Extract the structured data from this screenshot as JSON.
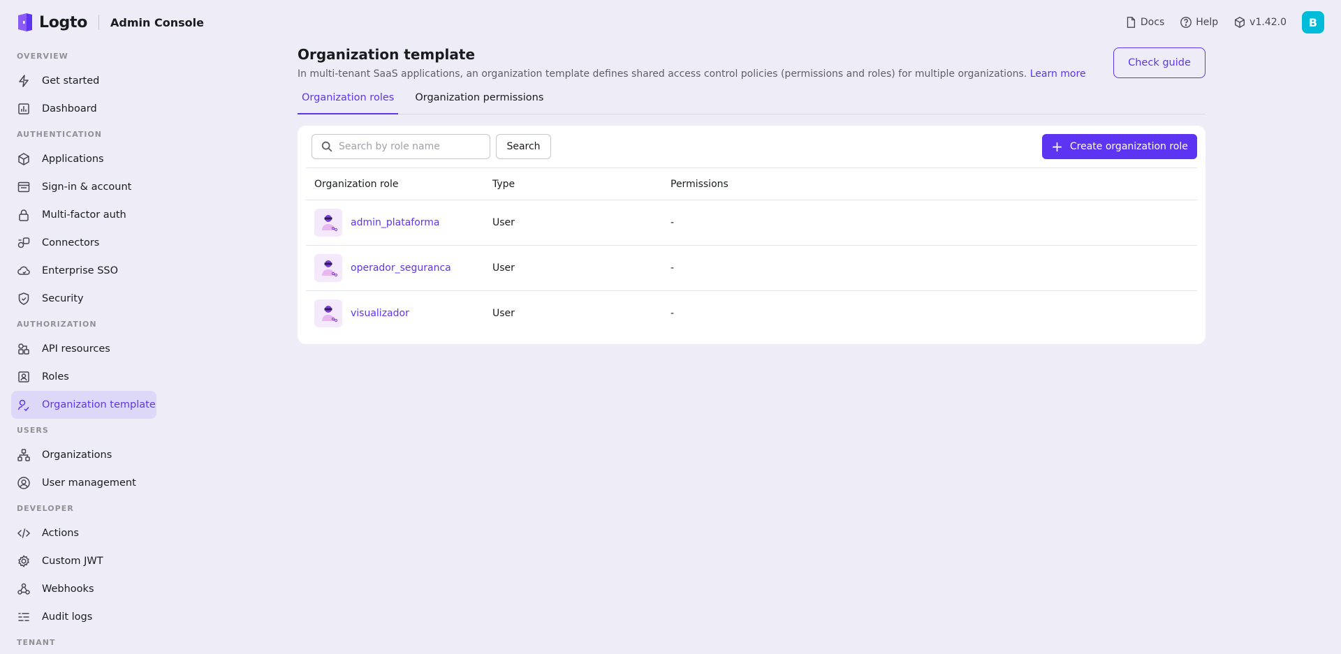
{
  "header": {
    "logo_text": "Logto",
    "app_title": "Admin Console",
    "docs_label": "Docs",
    "help_label": "Help",
    "version_label": "v1.42.0",
    "avatar_initial": "B"
  },
  "sidebar": {
    "sections": [
      {
        "title": "OVERVIEW",
        "items": [
          {
            "label": "Get started",
            "icon": "bolt-icon"
          },
          {
            "label": "Dashboard",
            "icon": "chart-icon"
          }
        ]
      },
      {
        "title": "AUTHENTICATION",
        "items": [
          {
            "label": "Applications",
            "icon": "cube-icon"
          },
          {
            "label": "Sign-in & account",
            "icon": "window-icon"
          },
          {
            "label": "Multi-factor auth",
            "icon": "lock-icon"
          },
          {
            "label": "Connectors",
            "icon": "plug-icon"
          },
          {
            "label": "Enterprise SSO",
            "icon": "cloud-icon"
          },
          {
            "label": "Security",
            "icon": "shield-icon"
          }
        ]
      },
      {
        "title": "AUTHORIZATION",
        "items": [
          {
            "label": "API resources",
            "icon": "api-icon"
          },
          {
            "label": "Roles",
            "icon": "role-icon"
          },
          {
            "label": "Organization template",
            "icon": "org-template-icon",
            "active": true
          }
        ]
      },
      {
        "title": "USERS",
        "items": [
          {
            "label": "Organizations",
            "icon": "organization-icon"
          },
          {
            "label": "User management",
            "icon": "user-circle-icon"
          }
        ]
      },
      {
        "title": "DEVELOPER",
        "items": [
          {
            "label": "Actions",
            "icon": "code-icon"
          },
          {
            "label": "Custom JWT",
            "icon": "gear-icon"
          },
          {
            "label": "Webhooks",
            "icon": "webhook-icon"
          },
          {
            "label": "Audit logs",
            "icon": "list-icon"
          }
        ]
      },
      {
        "title": "TENANT",
        "items": []
      }
    ]
  },
  "page": {
    "title": "Organization template",
    "subtitle": "In multi-tenant SaaS applications, an organization template defines shared access control policies (permissions and roles) for multiple organizations.",
    "learn_more": "Learn more",
    "check_guide": "Check guide",
    "tabs": [
      {
        "label": "Organization roles",
        "active": true
      },
      {
        "label": "Organization permissions",
        "active": false
      }
    ]
  },
  "toolbar": {
    "search_placeholder": "Search by role name",
    "search_button": "Search",
    "create_button": "Create organization role"
  },
  "table": {
    "columns": [
      "Organization role",
      "Type",
      "Permissions"
    ],
    "rows": [
      {
        "role": "admin_plataforma",
        "type": "User",
        "permissions": "-"
      },
      {
        "role": "operador_seguranca",
        "type": "User",
        "permissions": "-"
      },
      {
        "role": "visualizador",
        "type": "User",
        "permissions": "-"
      }
    ]
  },
  "colors": {
    "accent": "#5d34f2",
    "background": "#edecf7",
    "avatar": "#00bcd9"
  }
}
